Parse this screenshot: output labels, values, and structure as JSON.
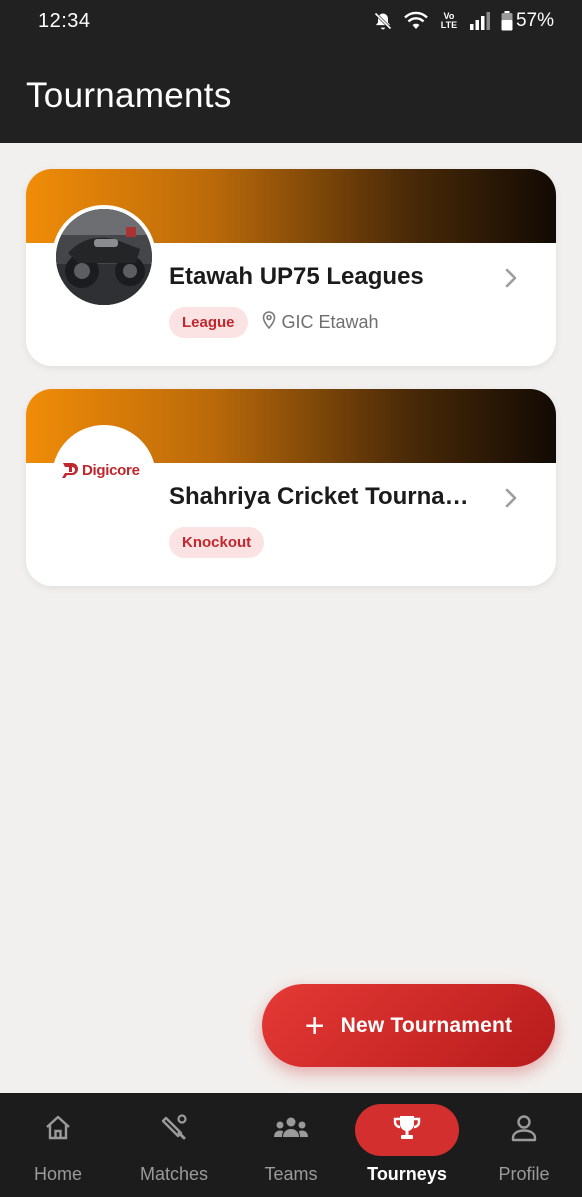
{
  "status_bar": {
    "time": "12:34",
    "battery": "57%",
    "network_badge": "Vo LTE"
  },
  "app_bar": {
    "title": "Tournaments"
  },
  "tournaments": [
    {
      "name": "Etawah UP75 Leagues",
      "type": "League",
      "location": "GIC Etawah"
    },
    {
      "name": "Shahriya Cricket Tournament",
      "type": "Knockout",
      "logo_text": "Digicore"
    }
  ],
  "fab": {
    "icon": "plus-icon",
    "label": "New Tournament"
  },
  "bottom_nav": {
    "items": [
      {
        "label": "Home",
        "icon": "home-icon",
        "active": false
      },
      {
        "label": "Matches",
        "icon": "cricket-bat-icon",
        "active": false
      },
      {
        "label": "Teams",
        "icon": "group-icon",
        "active": false
      },
      {
        "label": "Tourneys",
        "icon": "trophy-icon",
        "active": true
      },
      {
        "label": "Profile",
        "icon": "person-icon",
        "active": false
      }
    ]
  },
  "colors": {
    "primary": "#d32f2f",
    "appbar": "#212121",
    "background": "#f2f0ee",
    "badge_bg": "#fbe3e3",
    "banner_start": "#f08c08",
    "banner_end": "#120a04"
  }
}
